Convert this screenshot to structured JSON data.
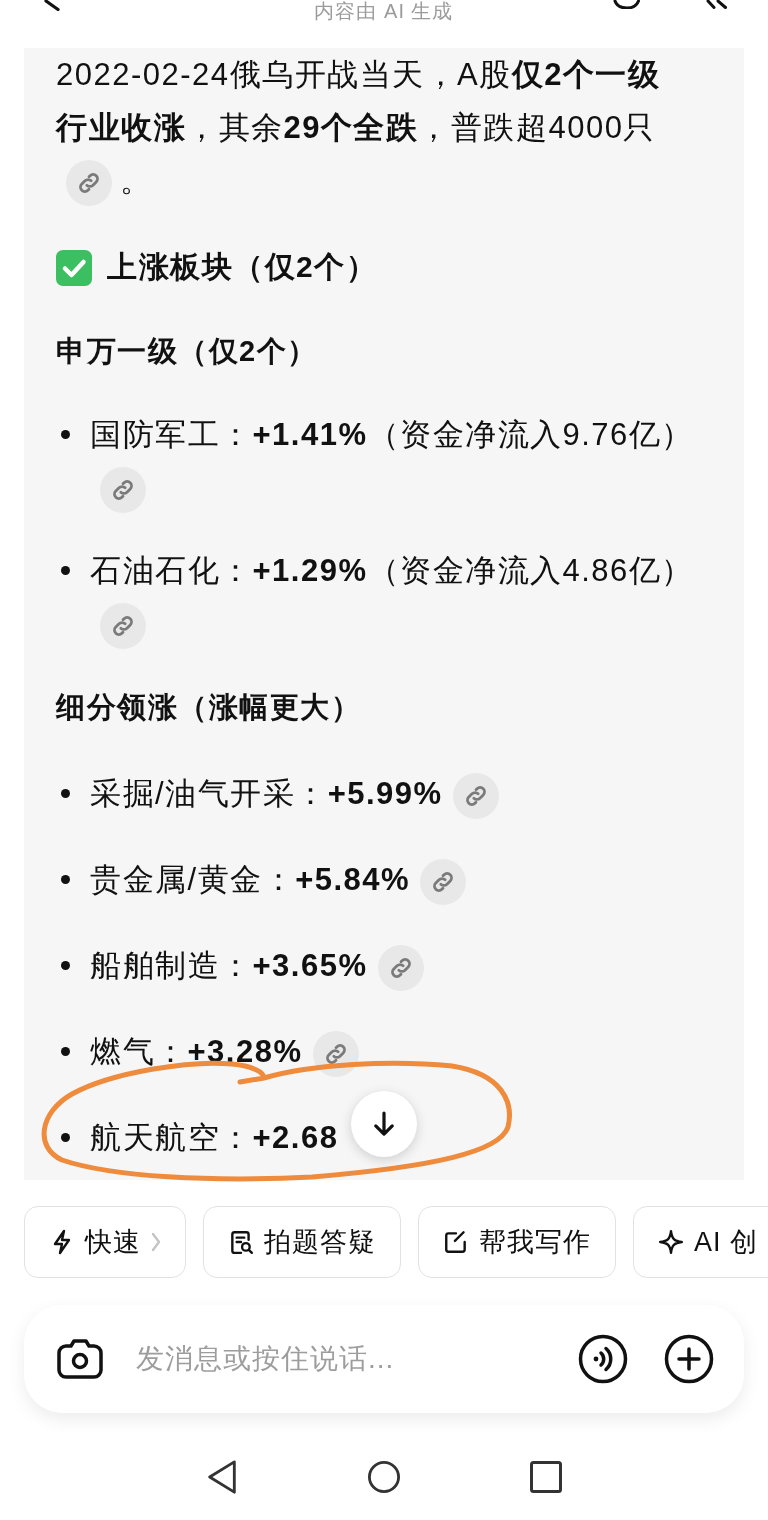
{
  "header": {
    "title": "内容由 AI 生成"
  },
  "answer": {
    "intro": {
      "text": "2022-02-24俄乌开战当天，A股**仅2个一级行业收涨**，其余**29个全跌**，普跌超4000只",
      "end": "。"
    },
    "heading": {
      "text": "上涨板块（仅2个）"
    },
    "groups": [
      {
        "title": "申万一级（仅2个）",
        "items": [
          {
            "text": "国防军工：**+1.41%**（资金净流入9.76亿）",
            "link": true
          },
          {
            "text": "石油石化：**+1.29%**（资金净流入4.86亿）",
            "link": true
          }
        ]
      },
      {
        "title": "细分领涨（涨幅更大）",
        "items": [
          {
            "text": "采掘/油气开采：**+5.99%**",
            "link": true
          },
          {
            "text": "贵金属/黄金：**+5.84%**",
            "link": true
          },
          {
            "text": "船舶制造：**+3.65%**",
            "link": true
          },
          {
            "text": "燃气：**+3.28%**",
            "link": true
          },
          {
            "text": "航天航空：**+2.68**",
            "link": false
          }
        ]
      }
    ]
  },
  "shortcuts": [
    {
      "label": "快速",
      "kind": "bolt",
      "menu": true
    },
    {
      "label": "拍题答疑",
      "kind": "scan",
      "menu": false
    },
    {
      "label": "帮我写作",
      "kind": "edit",
      "menu": false
    },
    {
      "label": "AI 创",
      "kind": "sparkle",
      "menu": false
    }
  ],
  "composer": {
    "placeholder": "发消息或按住说话..."
  }
}
